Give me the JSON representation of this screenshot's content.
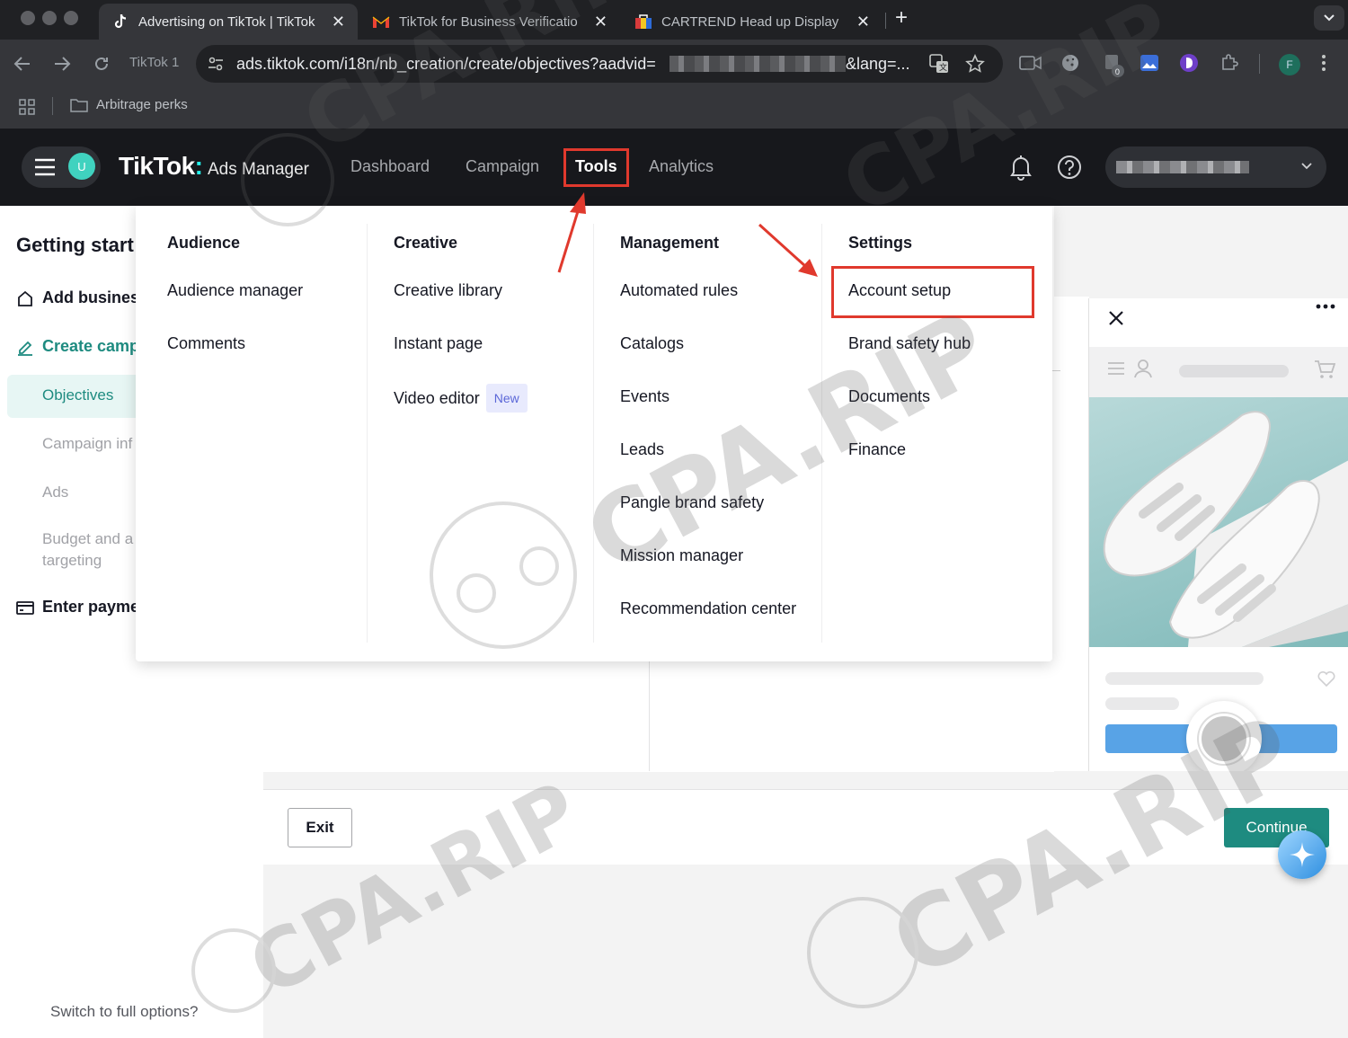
{
  "browser": {
    "tabs": [
      {
        "title": "Advertising on TikTok | TikTok",
        "favicon": "tiktok-icon",
        "active": true
      },
      {
        "title": "TikTok for Business Verificatio",
        "favicon": "gmail-icon",
        "active": false
      },
      {
        "title": "CARTREND Head up Display",
        "favicon": "shop-icon",
        "active": false
      }
    ],
    "profile_chip": "TikTok 1",
    "url": "ads.tiktok.com/i18n/nb_creation/create/objectives?aadvid=",
    "url_tail": "&lang=...",
    "bookmark_folder": "Arbitrage perks",
    "profile_initial": "F"
  },
  "header": {
    "user_initial": "U",
    "brand_logo": "TikTok",
    "brand_dot": ":",
    "brand_sub": "Ads Manager",
    "nav": {
      "dashboard": "Dashboard",
      "campaign": "Campaign",
      "tools": "Tools",
      "analytics": "Analytics"
    }
  },
  "leftnav": {
    "title": "Getting start",
    "steps": {
      "add_business": "Add business",
      "create_campaign": "Create camp",
      "objectives": "Objectives",
      "campaign_info": "Campaign inf",
      "ads": "Ads",
      "budget_line1": "Budget and a",
      "budget_line2": "targeting",
      "enter_payment": "Enter payme"
    },
    "switch_full": "Switch to full options?"
  },
  "tools_menu": {
    "audience": {
      "heading": "Audience",
      "items": [
        "Audience manager",
        "Comments"
      ]
    },
    "creative": {
      "heading": "Creative",
      "items": [
        "Creative library",
        "Instant page",
        "Video editor"
      ],
      "new_badge": "New"
    },
    "management": {
      "heading": "Management",
      "items": [
        "Automated rules",
        "Catalogs",
        "Events",
        "Leads",
        "Pangle brand safety",
        "Mission manager",
        "Recommendation center"
      ]
    },
    "settings": {
      "heading": "Settings",
      "items": [
        "Account setup",
        "Brand safety hub",
        "Documents",
        "Finance"
      ]
    }
  },
  "footer": {
    "exit_label": "Exit",
    "continue_label": "Continue"
  },
  "watermark": "CPA.RIP",
  "colors": {
    "annotation_red": "#e0392d",
    "primary_teal": "#1e8b80",
    "header_bg": "#17181c",
    "new_badge_bg": "#e8eafd"
  }
}
